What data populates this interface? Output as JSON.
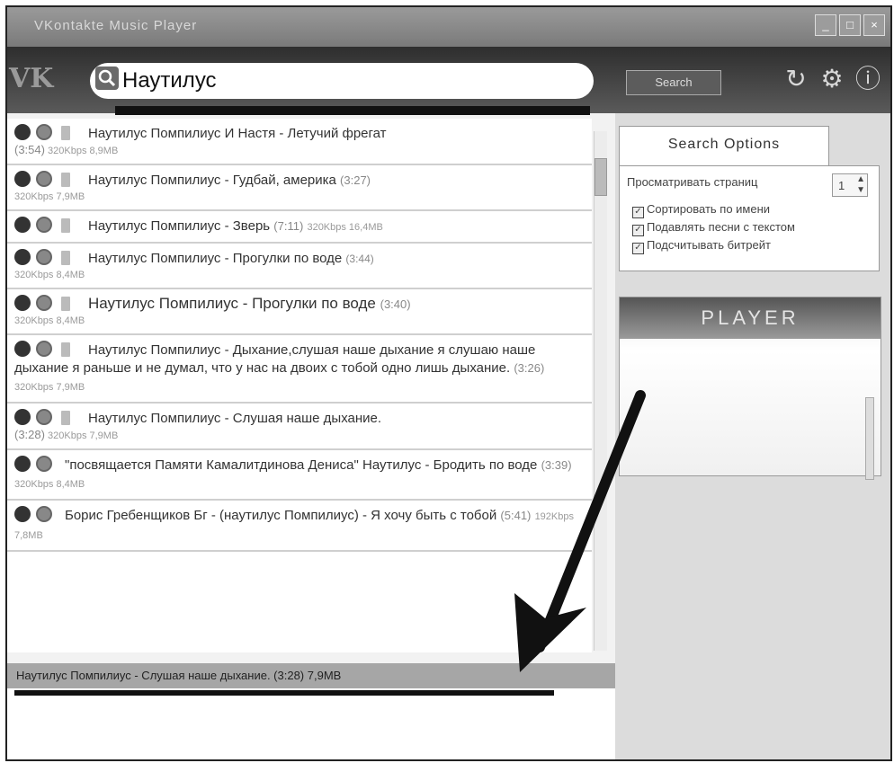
{
  "window": {
    "title": "VKontakte Music Player",
    "buttons": [
      "_",
      "□",
      "×"
    ]
  },
  "toolbar": {
    "logo": "VK",
    "search_value": "Наутилус",
    "search_button": "Search",
    "icons": [
      "refresh-icon",
      "gear-icon",
      "info-icon"
    ]
  },
  "results": [
    {
      "text": "Наутилус Помпилиус И Настя - Летучий фрегат",
      "dur": "(3:54)",
      "meta": "320Kbps 8,9MB"
    },
    {
      "text": "Наутилус Помпилиус - Гудбай, америка",
      "dur": "(3:27)",
      "meta": "320Kbps 7,9MB"
    },
    {
      "text": "Наутилус Помпилиус - Зверь",
      "dur": "(7:11)",
      "meta": "320Kbps 16,4MB"
    },
    {
      "text": "Наутилус Помпилиус - Прогулки по воде",
      "dur": "(3:44)",
      "meta": "320Kbps 8,4MB"
    },
    {
      "text": "Наутилус Помпилиус - Прогулки по воде",
      "dur": "(3:40)",
      "meta": "320Kbps 8,4MB"
    },
    {
      "text": "Наутилус Помпилиус - Дыхание,слушая наше дыхание я слушаю наше дыхание я раньше и не думал, что у нас на двоих с тобой одно лишь дыхание.",
      "dur": "(3:26)",
      "meta": "320Kbps 7,9MB"
    },
    {
      "text": "Наутилус Помпилиус - Слушая наше дыхание.",
      "dur": "(3:28)",
      "meta": "320Kbps 7,9MB"
    },
    {
      "text": "\"посвящается Памяти Камалитдинова Дениса\" Наутилус - Бродить по воде",
      "dur": "(3:39)",
      "meta": "320Kbps 8,4MB"
    },
    {
      "text": "Борис Гребенщиков Бг - (наутилус Помпилиус) - Я хочу быть с тобой",
      "dur": "(5:41)",
      "meta": "192Kbps 7,8MB"
    }
  ],
  "status": {
    "now_playing": "Наутилус Помпилиус - Слушая наше дыхание. (3:28) 7,9MB"
  },
  "options": {
    "tab": "Search Options",
    "pages_label": "Просматривать страниц",
    "pages_value": "1",
    "checks": [
      "Сортировать по имени",
      "Подавлять песни с текстом",
      "Подсчитывать битрейт"
    ]
  },
  "player": {
    "title": "PLAYER"
  }
}
